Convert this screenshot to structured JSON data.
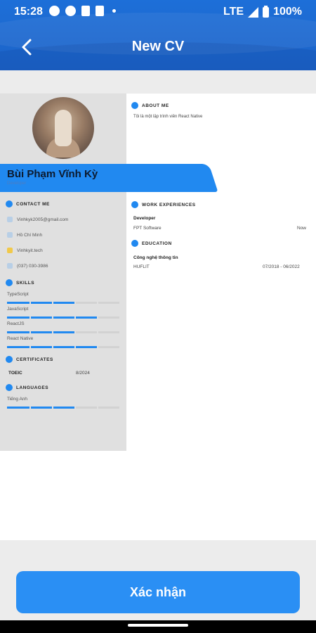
{
  "status_bar": {
    "time": "15:28",
    "network": "LTE",
    "battery": "100%"
  },
  "header": {
    "title": "New CV"
  },
  "cv": {
    "name": "Bùi Phạm Vĩnh Kỳ",
    "job_title": "Developer",
    "contact": {
      "heading": "CONTACT ME",
      "items": [
        {
          "icon": "mail-icon",
          "text": "Vinhkyk2005@gmail.com",
          "color": "#b8cfe6"
        },
        {
          "icon": "location-icon",
          "text": "Hồ Chí Minh",
          "color": "#b8cfe6"
        },
        {
          "icon": "web-icon",
          "text": "Vinhkyit.tech",
          "color": "#f1c94a"
        },
        {
          "icon": "phone-icon",
          "text": "(037) 030-3986",
          "color": "#b8cfe6"
        }
      ]
    },
    "skills": {
      "heading": "SKILLS",
      "items": [
        {
          "name": "TypeScript",
          "level": 0.6
        },
        {
          "name": "JavaScript",
          "level": 0.8
        },
        {
          "name": "ReactJS",
          "level": 0.6
        },
        {
          "name": "React Native",
          "level": 0.8
        }
      ]
    },
    "certificates": {
      "heading": "CERTIFICATES",
      "items": [
        {
          "name": "TOEIC",
          "date": "8/2024"
        }
      ]
    },
    "languages": {
      "heading": "LANGUAGES",
      "items": [
        {
          "name": "Tiếng Anh",
          "level": 0.6
        }
      ]
    },
    "about": {
      "heading": "ABOUT ME",
      "text": "Tôi là một lập trình viên React Native"
    },
    "work": {
      "heading": "WORK EXPERIENCES",
      "items": [
        {
          "title": "Developer",
          "company": "FPT Software",
          "period": "Now"
        }
      ]
    },
    "education": {
      "heading": "EDUCATION",
      "items": [
        {
          "major": "Công nghệ thông tin",
          "school": "HUFLIT",
          "period": "07/2018 - 06/2022"
        }
      ]
    }
  },
  "actions": {
    "confirm_label": "Xác nhận"
  },
  "colors": {
    "primary": "#1d6fd8",
    "accent": "#2189f0",
    "sidebar": "#e0e0e0"
  }
}
